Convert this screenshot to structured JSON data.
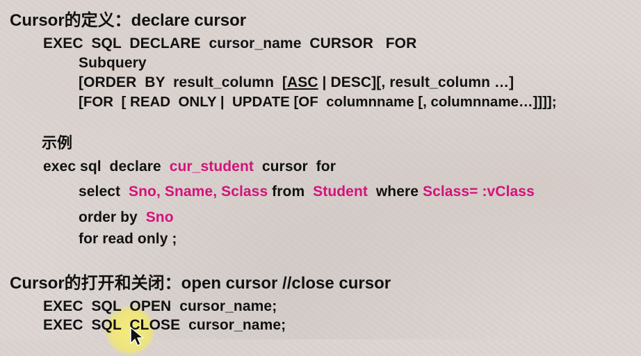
{
  "section1": {
    "title": "Cursor的定义：declare cursor",
    "syntax": {
      "line1": "EXEC  SQL  DECLARE  cursor_name  CURSOR   FOR",
      "line2": "Subquery",
      "line3_pre": "[ORDER  BY  result_column  [",
      "line3_asc": "ASC",
      "line3_post": " | DESC][, result_column …]",
      "line4": "[FOR  [ READ  ONLY |  UPDATE [OF  columnname [, columnname…]]]];"
    }
  },
  "section2": {
    "title": "示例",
    "line1": {
      "a": "exec sql  declare  ",
      "b": "cur_student",
      "c": "  cursor  for"
    },
    "line2": {
      "a": "select  ",
      "b": "Sno, Sname, Sclass",
      "c": " from  ",
      "d": "Student",
      "e": "  where ",
      "f": "Sclass= :vClass"
    },
    "line3": {
      "a": "order by  ",
      "b": "Sno"
    },
    "line4": "for read only ;"
  },
  "section3": {
    "title": "Cursor的打开和关闭：open cursor //close cursor",
    "line1": "EXEC  SQL  OPEN  cursor_name;",
    "line2": "EXEC  SQL  CLOSE  cursor_name;"
  },
  "icons": {
    "cursor_highlight": "mouse-highlight",
    "pointer": "mouse-pointer-icon"
  },
  "colors": {
    "text": "#111111",
    "highlight": "#d4127a"
  }
}
